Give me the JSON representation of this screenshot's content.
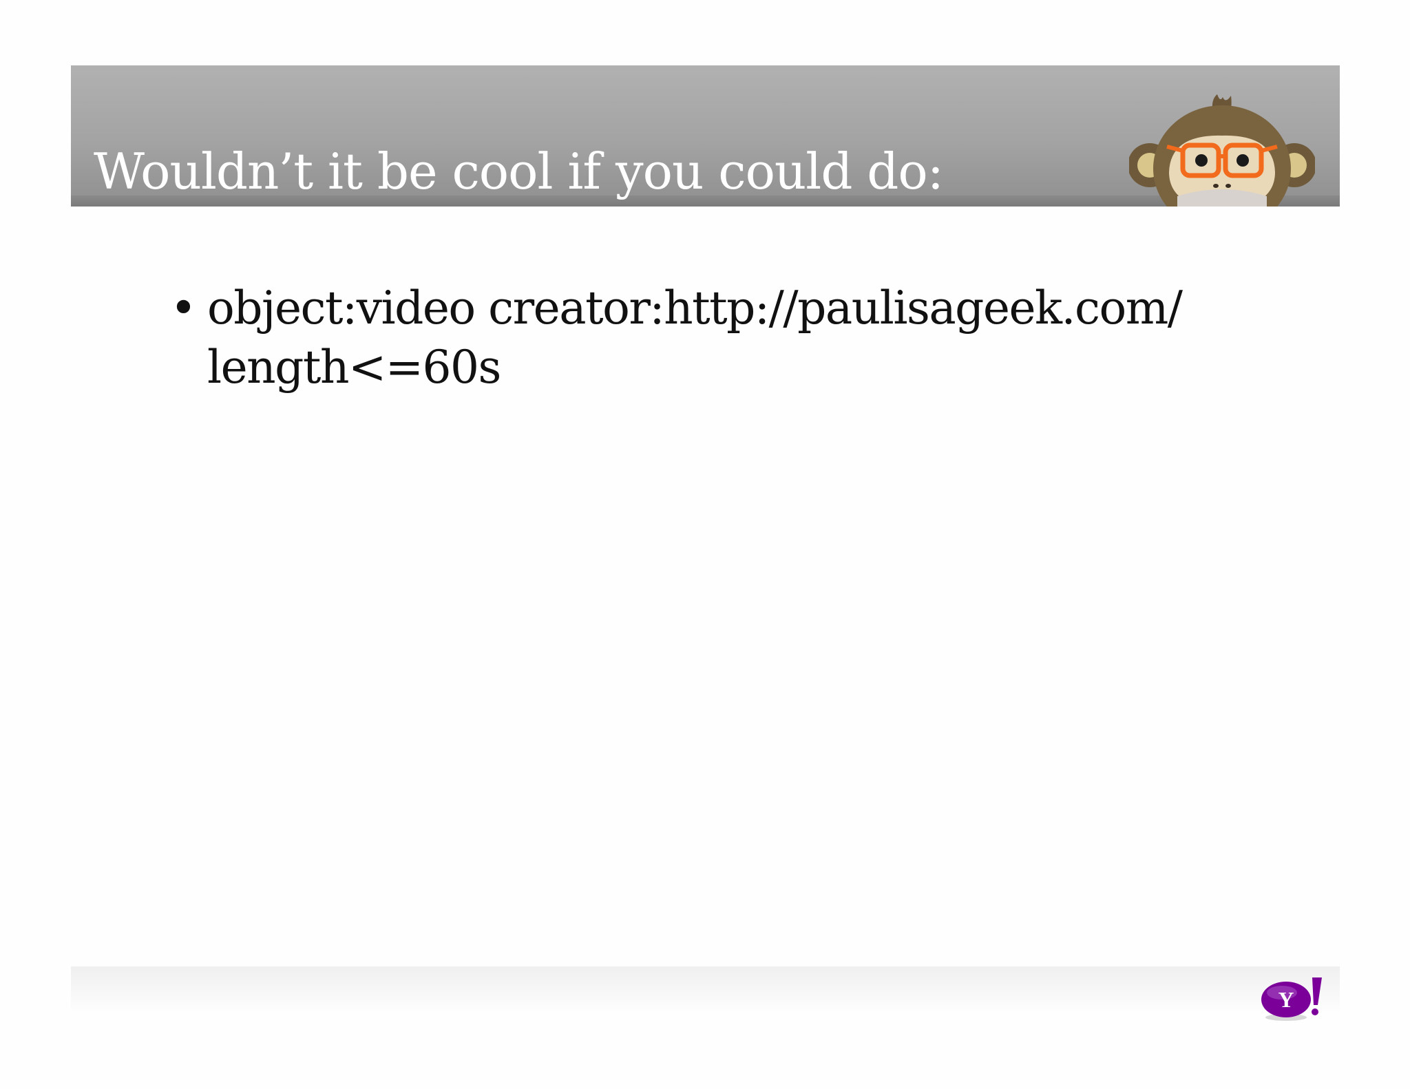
{
  "slide": {
    "title": "Wouldn’t it be cool if you could do:",
    "bullets": [
      {
        "lines": [
          "object:video creator:http://paulisageek.com/",
          "length<=60s"
        ]
      }
    ]
  },
  "icons": {
    "header_mascot": "monkey-with-orange-glasses-icon",
    "footer_logo": "yahoo-logo"
  },
  "colors": {
    "header_band": "#a3a3a3",
    "title_text": "#ffffff",
    "body_text": "#111111",
    "glasses_orange": "#f26a1b",
    "yahoo_purple": "#7b0099"
  }
}
